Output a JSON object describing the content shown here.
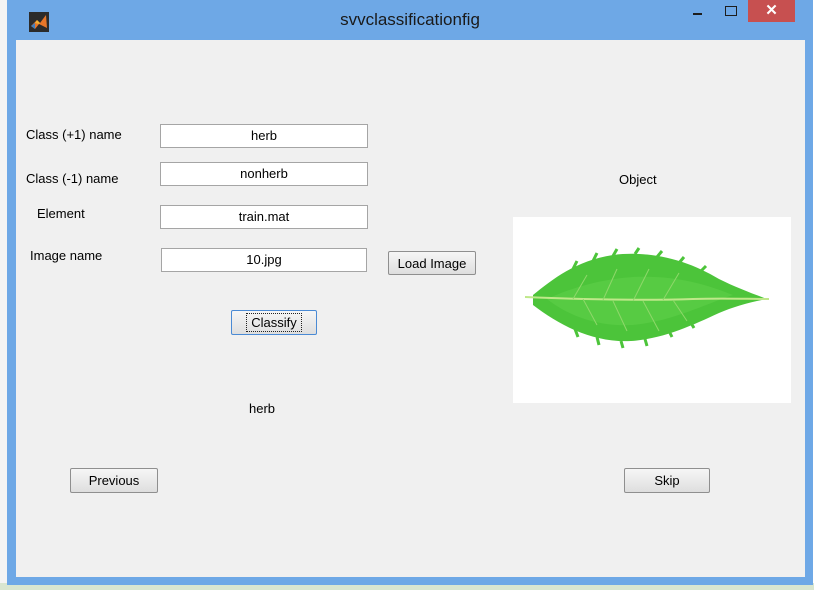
{
  "window": {
    "title": "svvclassificationfig",
    "close_glyph": "✕"
  },
  "form": {
    "class_pos_label": "Class (+1) name",
    "class_pos_value": "herb",
    "class_neg_label": "Class (-1) name",
    "class_neg_value": "nonherb",
    "element_label": "Element",
    "element_value": "train.mat",
    "image_name_label": "Image name",
    "image_name_value": "10.jpg"
  },
  "buttons": {
    "load_image": "Load Image",
    "classify": "Classify",
    "previous": "Previous",
    "skip": "Skip"
  },
  "result": {
    "label": "herb"
  },
  "object_panel": {
    "title": "Object"
  },
  "colors": {
    "titlebar": "#6ea8e6",
    "close": "#c75050",
    "client": "#f0f0f0",
    "leaf": "#4cc43a"
  }
}
